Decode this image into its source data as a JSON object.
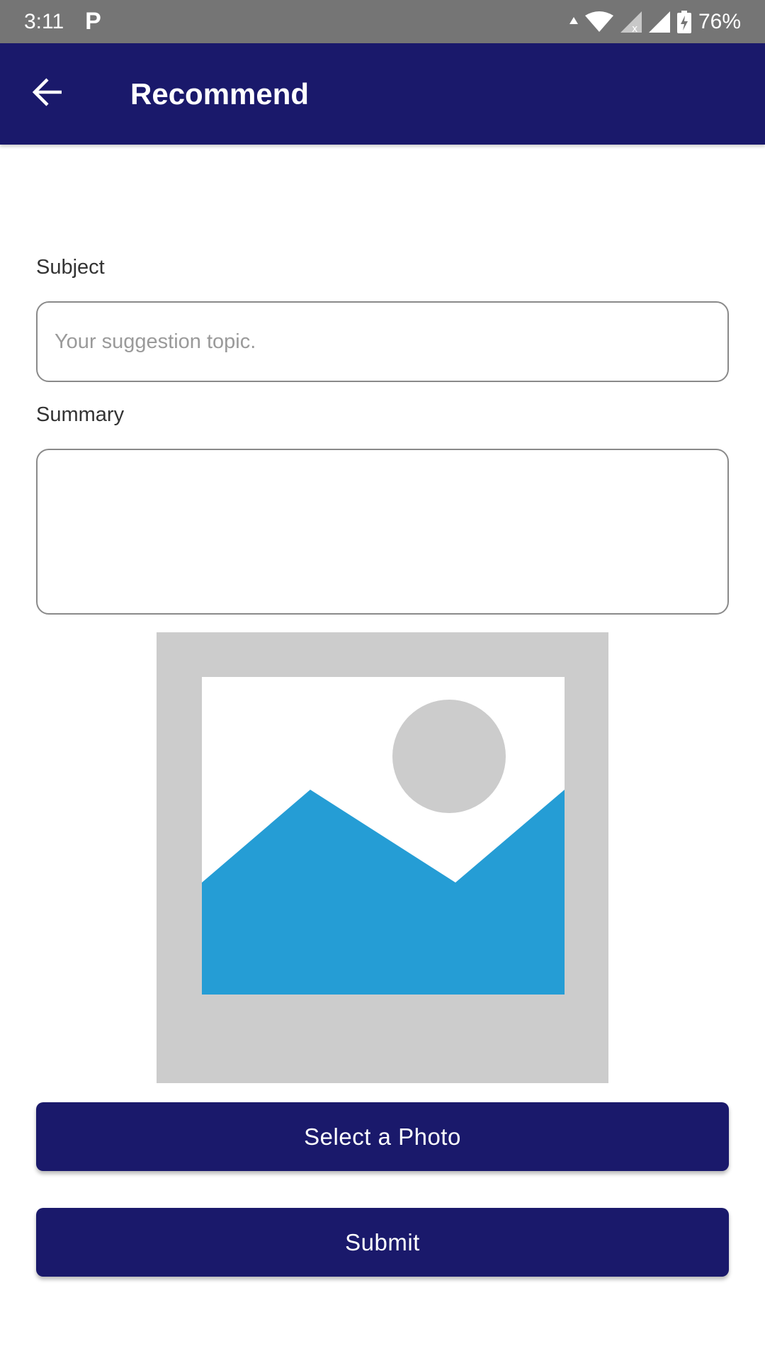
{
  "status_bar": {
    "time": "3:11",
    "app_indicator": "P",
    "battery": "76%",
    "icons": [
      "data-arrow-icon",
      "wifi-icon",
      "signal-x-icon",
      "signal-icon",
      "battery-charging-icon"
    ]
  },
  "app_bar": {
    "back_icon": "arrow-left-icon",
    "title": "Recommend"
  },
  "form": {
    "subject_label": "Subject",
    "subject_placeholder": "Your suggestion topic.",
    "subject_value": "",
    "summary_label": "Summary",
    "summary_value": ""
  },
  "photo": {
    "icon": "image-placeholder-icon"
  },
  "buttons": {
    "select_photo": "Select a Photo",
    "submit": "Submit"
  },
  "colors": {
    "primary": "#1a196b",
    "status_bar": "#757575",
    "placeholder_bg": "#cccccc",
    "image_blue": "#259dd5"
  }
}
